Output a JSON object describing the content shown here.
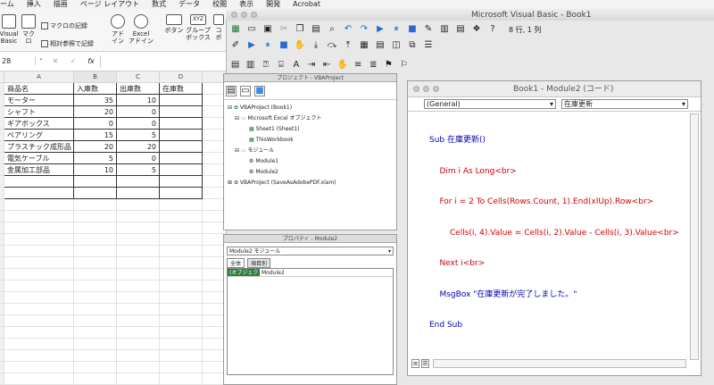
{
  "excel": {
    "menu": [
      "ーム",
      "挿入",
      "描画",
      "ページ レイアウト",
      "数式",
      "データ",
      "校閲",
      "表示",
      "開発",
      "Acrobat"
    ],
    "ribbon": {
      "visual_basic": "Visual\nBasic",
      "macro": "マクロ",
      "record_macro": "マクロの記録",
      "relative_ref": "相対参照で記録",
      "addin": "アド\nイン",
      "excel_addin": "Excel\nアドイン",
      "button": "ボタン",
      "group_box": "グループ\nボックス",
      "xyz_label": "XYZ",
      "combo": "コ\nボ"
    },
    "name_box": "28",
    "fx": "fx",
    "columns": [
      "A",
      "B",
      "C",
      "D"
    ],
    "rows": [
      [
        "商品名",
        "入庫数",
        "出庫数",
        "在庫数"
      ],
      [
        "モーター",
        "35",
        "10",
        ""
      ],
      [
        "シャフト",
        "20",
        "0",
        ""
      ],
      [
        "ギアボックス",
        "0",
        "0",
        ""
      ],
      [
        "ベアリング",
        "15",
        "5",
        ""
      ],
      [
        "プラスチック成形品",
        "20",
        "20",
        ""
      ],
      [
        "電気ケーブル",
        "5",
        "0",
        ""
      ],
      [
        "金属加工部品",
        "10",
        "5",
        ""
      ]
    ]
  },
  "vbe": {
    "title": "Microsoft Visual Basic - Book1",
    "status": "8 行, 1 列",
    "project_panel": {
      "title": "プロジェクト - VBAProject",
      "tree": [
        "VBAProject (Book1)",
        "Microsoft Excel オブジェクト",
        "Sheet1 (Sheet1)",
        "ThisWorkbook",
        "モジュール",
        "Module1",
        "Module2",
        "VBAProject (SaveAsAdobePDF.xlam)"
      ]
    },
    "props_panel": {
      "title": "プロパティ - Module2",
      "selector": "Module2  モジュール",
      "tab_all": "全体",
      "tab_category": "項目別",
      "prop_name": "(オブジェクト名)",
      "prop_value": "Module2"
    },
    "code_window": {
      "title": "Book1 - Module2 (コード)",
      "general": "(General)",
      "proc": "在庫更新",
      "lines": [
        "Sub 在庫更新()",
        "    Dim i As Long<br>",
        "    For i = 2 To Cells(Rows.Count, 1).End(xlUp).Row<br>",
        "        Cells(i, 4).Value = Cells(i, 2).Value - Cells(i, 3).Value<br>",
        "    Next i<br>",
        "    MsgBox \"在庫更新が完了しました。\"",
        "End Sub"
      ]
    },
    "colors": {
      "keyword": "#0000b8",
      "error": "#d40000"
    }
  }
}
